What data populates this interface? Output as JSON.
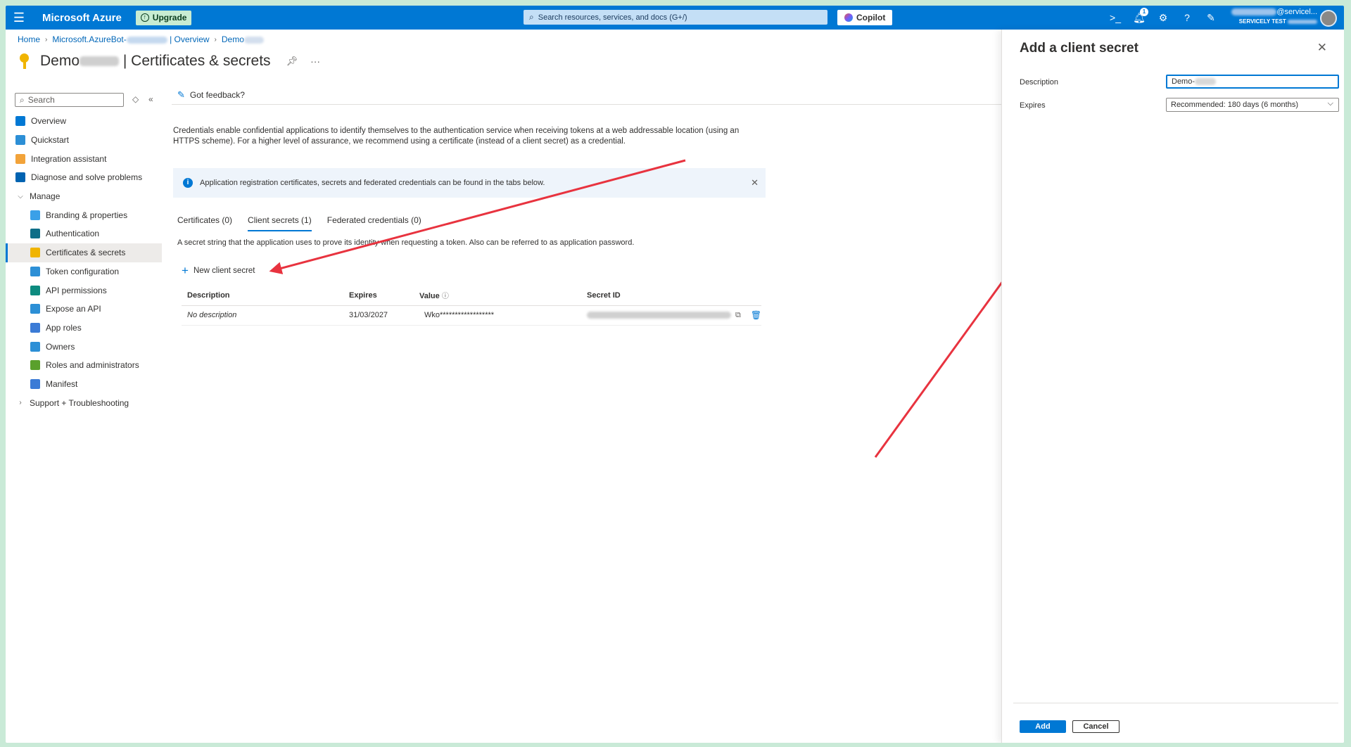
{
  "topbar": {
    "brand": "Microsoft Azure",
    "upgrade": "Upgrade",
    "search_placeholder": "Search resources, services, and docs (G+/)",
    "copilot": "Copilot",
    "notification_count": "1",
    "user_email_suffix": "@servicel...",
    "user_org": "SERVICELY TEST"
  },
  "breadcrumb": {
    "home": "Home",
    "app": "Microsoft.AzureBot-",
    "app_suffix": "| Overview",
    "current": "Demo"
  },
  "page": {
    "title_prefix": "Demo",
    "title_suffix": "| Certificates & secrets",
    "more": "···"
  },
  "sidebar": {
    "search_placeholder": "Search",
    "items": [
      {
        "label": "Overview",
        "sub": false,
        "icon_color": "#0078d4",
        "icon": "grid-icon"
      },
      {
        "label": "Quickstart",
        "sub": false,
        "icon_color": "#2c8fd6",
        "icon": "cloud-icon"
      },
      {
        "label": "Integration assistant",
        "sub": false,
        "icon_color": "#f2a33a",
        "icon": "rocket-icon"
      },
      {
        "label": "Diagnose and solve problems",
        "sub": false,
        "icon_color": "#0063b1",
        "icon": "wrench-icon"
      },
      {
        "label": "Manage",
        "sub": false,
        "group": true,
        "chevron": "v"
      },
      {
        "label": "Branding & properties",
        "sub": true,
        "icon_color": "#3aa0e8",
        "icon": "branding-icon"
      },
      {
        "label": "Authentication",
        "sub": true,
        "icon_color": "#0e6e88",
        "icon": "auth-icon"
      },
      {
        "label": "Certificates & secrets",
        "sub": true,
        "active": true,
        "icon_color": "#f0b400",
        "icon": "key-icon"
      },
      {
        "label": "Token configuration",
        "sub": true,
        "icon_color": "#2c8fd6",
        "icon": "token-icon"
      },
      {
        "label": "API permissions",
        "sub": true,
        "icon_color": "#0d8b7f",
        "icon": "api-permissions-icon"
      },
      {
        "label": "Expose an API",
        "sub": true,
        "icon_color": "#2c8fd6",
        "icon": "cloud-api-icon"
      },
      {
        "label": "App roles",
        "sub": true,
        "icon_color": "#3b7bd6",
        "icon": "app-roles-icon"
      },
      {
        "label": "Owners",
        "sub": true,
        "icon_color": "#2c8fd6",
        "icon": "owners-icon"
      },
      {
        "label": "Roles and administrators",
        "sub": true,
        "icon_color": "#5aa02c",
        "icon": "roles-icon"
      },
      {
        "label": "Manifest",
        "sub": true,
        "icon_color": "#3b7bd6",
        "icon": "manifest-icon"
      },
      {
        "label": "Support + Troubleshooting",
        "sub": false,
        "group": true,
        "chevron": ">"
      }
    ]
  },
  "main": {
    "feedback": "Got feedback?",
    "intro": "Credentials enable confidential applications to identify themselves to the authentication service when receiving tokens at a web addressable location (using an HTTPS scheme). For a higher level of assurance, we recommend using a certificate (instead of a client secret) as a credential.",
    "info": "Application registration certificates, secrets and federated credentials can be found in the tabs below.",
    "tabs": [
      {
        "label": "Certificates (0)",
        "active": false
      },
      {
        "label": "Client secrets (1)",
        "active": true
      },
      {
        "label": "Federated credentials (0)",
        "active": false
      }
    ],
    "secret_desc": "A secret string that the application uses to prove its identity when requesting a token. Also can be referred to as application password.",
    "new_secret": "New client secret",
    "table": {
      "headers": [
        "Description",
        "Expires",
        "Value",
        "Secret ID"
      ],
      "rows": [
        {
          "description": "No description",
          "expires": "31/03/2027",
          "value": "Wko******************",
          "secret_id": ""
        }
      ]
    }
  },
  "panel": {
    "title": "Add a client secret",
    "description_label": "Description",
    "description_value": "Demo-",
    "expires_label": "Expires",
    "expires_value": "Recommended: 180 days (6 months)",
    "add": "Add",
    "cancel": "Cancel"
  },
  "colors": {
    "accent": "#0078d4",
    "annotation_arrow": "#e8333f",
    "background_frame": "#c9ead7"
  }
}
